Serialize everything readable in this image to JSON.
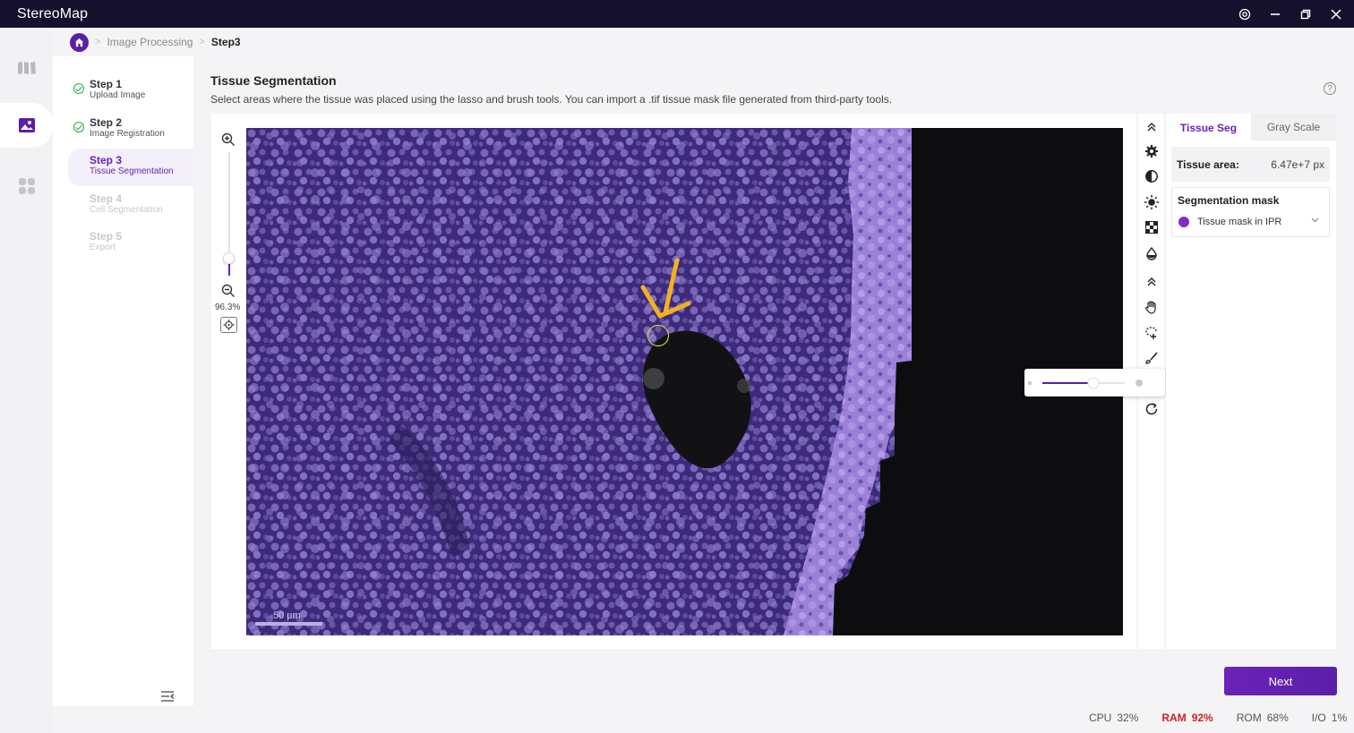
{
  "window": {
    "title": "StereoMap"
  },
  "breadcrumb": {
    "items": [
      "Image Processing"
    ],
    "current": "Step3"
  },
  "steps": [
    {
      "title": "Step 1",
      "subtitle": "Upload Image",
      "state": "done"
    },
    {
      "title": "Step 2",
      "subtitle": "Image Registration",
      "state": "done"
    },
    {
      "title": "Step 3",
      "subtitle": "Tissue Segmentation",
      "state": "active"
    },
    {
      "title": "Step 4",
      "subtitle": "Cell Segmentation",
      "state": "disabled"
    },
    {
      "title": "Step 5",
      "subtitle": "Export",
      "state": "disabled"
    }
  ],
  "page": {
    "title": "Tissue Segmentation",
    "description": "Select areas where the tissue was placed using the lasso and brush tools. You can import a .tif tissue mask file generated from third-party tools."
  },
  "viewer": {
    "zoom_percent": "96.3%",
    "zoom_level": 0.12,
    "scale_bar": "50 µm"
  },
  "brush_size_level": 0.62,
  "tabs": [
    {
      "label": "Tissue Seg"
    },
    {
      "label": "Gray Scale"
    }
  ],
  "tissue_area": {
    "label": "Tissue area:",
    "value": "6.47e+7 px"
  },
  "segmentation_mask": {
    "title": "Segmentation mask",
    "selected": "Tissue mask in IPR",
    "color": "#7b2fc9"
  },
  "actions": {
    "next": "Next"
  },
  "status": {
    "cpu_label": "CPU",
    "cpu": "32%",
    "ram_label": "RAM",
    "ram": "92%",
    "rom_label": "ROM",
    "rom": "68%",
    "io_label": "I/O",
    "io": "1%"
  },
  "colors": {
    "accent": "#6b22b5",
    "titlebar": "#15112c",
    "mask": "#9b7fd9",
    "annotation_arrow": "#f2b21f",
    "warning": "#d21e1e"
  }
}
